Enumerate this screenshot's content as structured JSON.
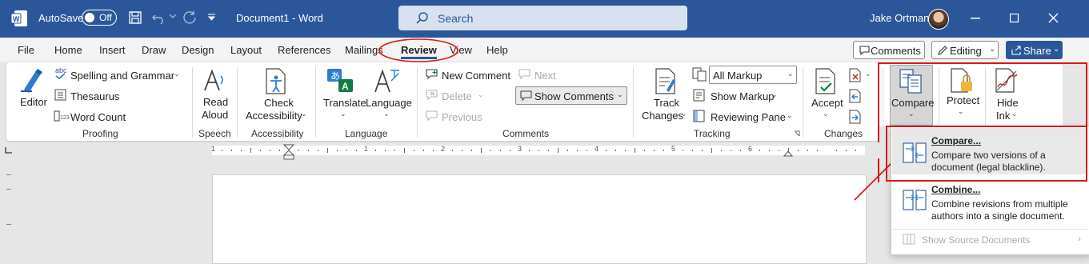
{
  "titlebar": {
    "autosave_label": "AutoSave",
    "autosave_state": "Off",
    "document_title": "Document1  -  Word",
    "search_placeholder": "Search",
    "user_name": "Jake Ortman",
    "bg_color": "#2b579a"
  },
  "tabs": [
    "File",
    "Home",
    "Insert",
    "Draw",
    "Design",
    "Layout",
    "References",
    "Mailings",
    "Review",
    "View",
    "Help"
  ],
  "active_tab": "Review",
  "topright": {
    "comments": "Comments",
    "editing": "Editing",
    "share": "Share"
  },
  "ribbon": {
    "proofing": {
      "editor": "Editor",
      "spelling": "Spelling and Grammar",
      "thesaurus": "Thesaurus",
      "word_count": "Word Count",
      "group": "Proofing",
      "abc": "abc",
      "count_icon": "123"
    },
    "speech": {
      "read1": "Read",
      "read2": "Aloud",
      "group": "Speech"
    },
    "accessibility": {
      "check1": "Check",
      "check2": "Accessibility",
      "group": "Accessibility"
    },
    "language": {
      "translate": "Translate",
      "language": "Language",
      "group": "Language"
    },
    "comments": {
      "new": "New Comment",
      "delete": "Delete",
      "previous": "Previous",
      "next": "Next",
      "show": "Show Comments",
      "group": "Comments"
    },
    "tracking": {
      "track1": "Track",
      "track2": "Changes",
      "all_markup": "All Markup",
      "show_markup": "Show Markup",
      "reviewing_pane": "Reviewing Pane",
      "group": "Tracking"
    },
    "changes": {
      "accept": "Accept",
      "group": "Changes"
    },
    "compare": {
      "label": "Compare"
    },
    "protect": {
      "label": "Protect"
    },
    "ink": {
      "line1": "Hide",
      "line2": "Ink"
    }
  },
  "ruler": {
    "numbers": [
      "1",
      "1",
      "2",
      "3",
      "4",
      "5",
      "6"
    ]
  },
  "compare_menu": {
    "compare_title": "Compare...",
    "compare_desc1": "Compare two versions of a",
    "compare_desc2": "document (legal blackline).",
    "combine_title": "Combine...",
    "combine_desc1": "Combine revisions from multiple",
    "combine_desc2": "authors into a single document.",
    "show_source": "Show Source Documents"
  },
  "annotation_color": "#d71a1a"
}
